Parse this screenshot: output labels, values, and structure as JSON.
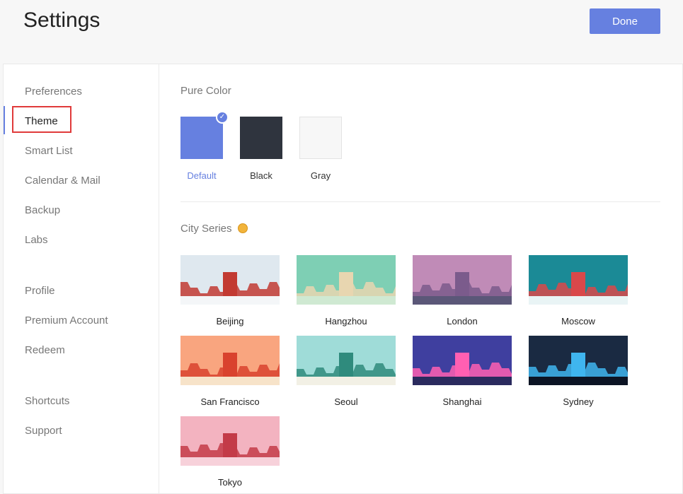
{
  "header": {
    "title": "Settings",
    "done_label": "Done"
  },
  "sidebar": {
    "groups": [
      [
        "Preferences",
        "Theme",
        "Smart List",
        "Calendar & Mail",
        "Backup",
        "Labs"
      ],
      [
        "Profile",
        "Premium Account",
        "Redeem"
      ],
      [
        "Shortcuts",
        "Support"
      ]
    ],
    "active": "Theme"
  },
  "pure_color": {
    "title": "Pure Color",
    "swatches": [
      {
        "label": "Default",
        "color": "#6680e0",
        "selected": true
      },
      {
        "label": "Black",
        "color": "#2f343e",
        "selected": false
      },
      {
        "label": "Gray",
        "color": "#f7f7f7",
        "selected": false
      }
    ]
  },
  "city_series": {
    "title": "City Series",
    "title_icon": "smiley-emoji-icon",
    "cities": [
      {
        "label": "Beijing",
        "sky": "#dfe8ef",
        "ground": "#f4f6f8",
        "accent": "#c23a32"
      },
      {
        "label": "Hangzhou",
        "sky": "#7ecfb4",
        "ground": "#cfe9d2",
        "accent": "#e8d6b0"
      },
      {
        "label": "London",
        "sky": "#c08bb7",
        "ground": "#5b5778",
        "accent": "#7b5b8c"
      },
      {
        "label": "Moscow",
        "sky": "#1b8a96",
        "ground": "#e9f4f5",
        "accent": "#d9484a"
      },
      {
        "label": "San Francisco",
        "sky": "#f9a57f",
        "ground": "#f7e3c9",
        "accent": "#d9422e"
      },
      {
        "label": "Seoul",
        "sky": "#9fdcd8",
        "ground": "#f2f0e5",
        "accent": "#2f8b7d"
      },
      {
        "label": "Shanghai",
        "sky": "#3f3f9f",
        "ground": "#2a2a5e",
        "accent": "#ff5fb2"
      },
      {
        "label": "Sydney",
        "sky": "#1a2a42",
        "ground": "#0c1424",
        "accent": "#3fb5ef"
      },
      {
        "label": "Tokyo",
        "sky": "#f3b3c0",
        "ground": "#f7d1da",
        "accent": "#c33b48"
      }
    ]
  }
}
